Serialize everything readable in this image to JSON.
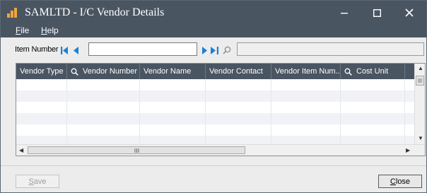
{
  "window": {
    "title": "SAMLTD - I/C Vendor Details",
    "accent_color": "#4a5562",
    "icon": "bar-chart-app-icon",
    "controls": [
      "minimize-icon",
      "maximize-icon",
      "close-icon"
    ]
  },
  "menu": {
    "file_key": "F",
    "file_rest": "ile",
    "help_key": "H",
    "help_rest": "elp"
  },
  "item_bar": {
    "label": "Item Number",
    "value": "",
    "description": "",
    "nav_icons": [
      "first-record-icon",
      "previous-record-icon",
      "next-record-icon",
      "last-record-icon",
      "search-icon"
    ],
    "nav_color": "#1f7fd2"
  },
  "grid": {
    "columns": [
      {
        "label": "Vendor Type",
        "icon": ""
      },
      {
        "label": "Vendor Number",
        "icon": "search-icon"
      },
      {
        "label": "Vendor Name",
        "icon": ""
      },
      {
        "label": "Vendor Contact",
        "icon": ""
      },
      {
        "label": "Vendor Item Num...",
        "icon": ""
      },
      {
        "label": "Cost Unit",
        "icon": "search-icon"
      }
    ],
    "row_count": 6
  },
  "buttons": {
    "save_key": "S",
    "save_rest": "ave",
    "close_key": "C",
    "close_rest": "lose"
  }
}
